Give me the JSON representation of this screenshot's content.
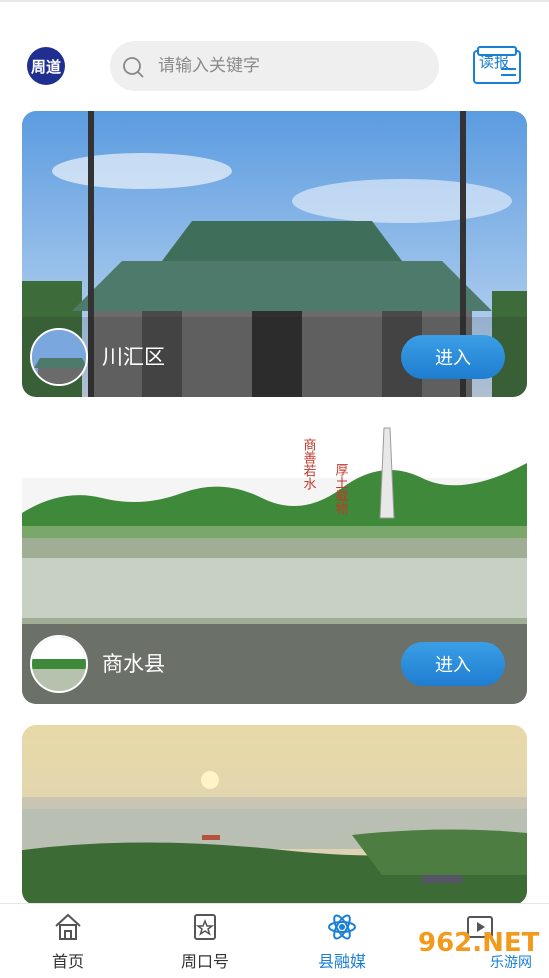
{
  "header": {
    "logo_text": "周道",
    "search_placeholder": "请输入关键字",
    "read_label": "读报"
  },
  "cards": [
    {
      "name": "川汇区",
      "button": "进入"
    },
    {
      "name": "商水县",
      "button": "进入",
      "image_text_1": "商善若水",
      "image_text_2": "厚土载物"
    },
    {
      "name": "",
      "button": ""
    }
  ],
  "tabbar": {
    "items": [
      {
        "label": "首页",
        "icon": "home-icon"
      },
      {
        "label": "周口号",
        "icon": "star-bookmark-icon"
      },
      {
        "label": "县融媒",
        "icon": "atom-icon",
        "active": true
      },
      {
        "label": "",
        "icon": "video-icon"
      }
    ]
  },
  "watermark": {
    "text": "962.NET",
    "subtext": "乐游网"
  },
  "colors": {
    "accent": "#1a7fd6",
    "button": "#2b8ddc",
    "logo": "#1e2f8f"
  }
}
